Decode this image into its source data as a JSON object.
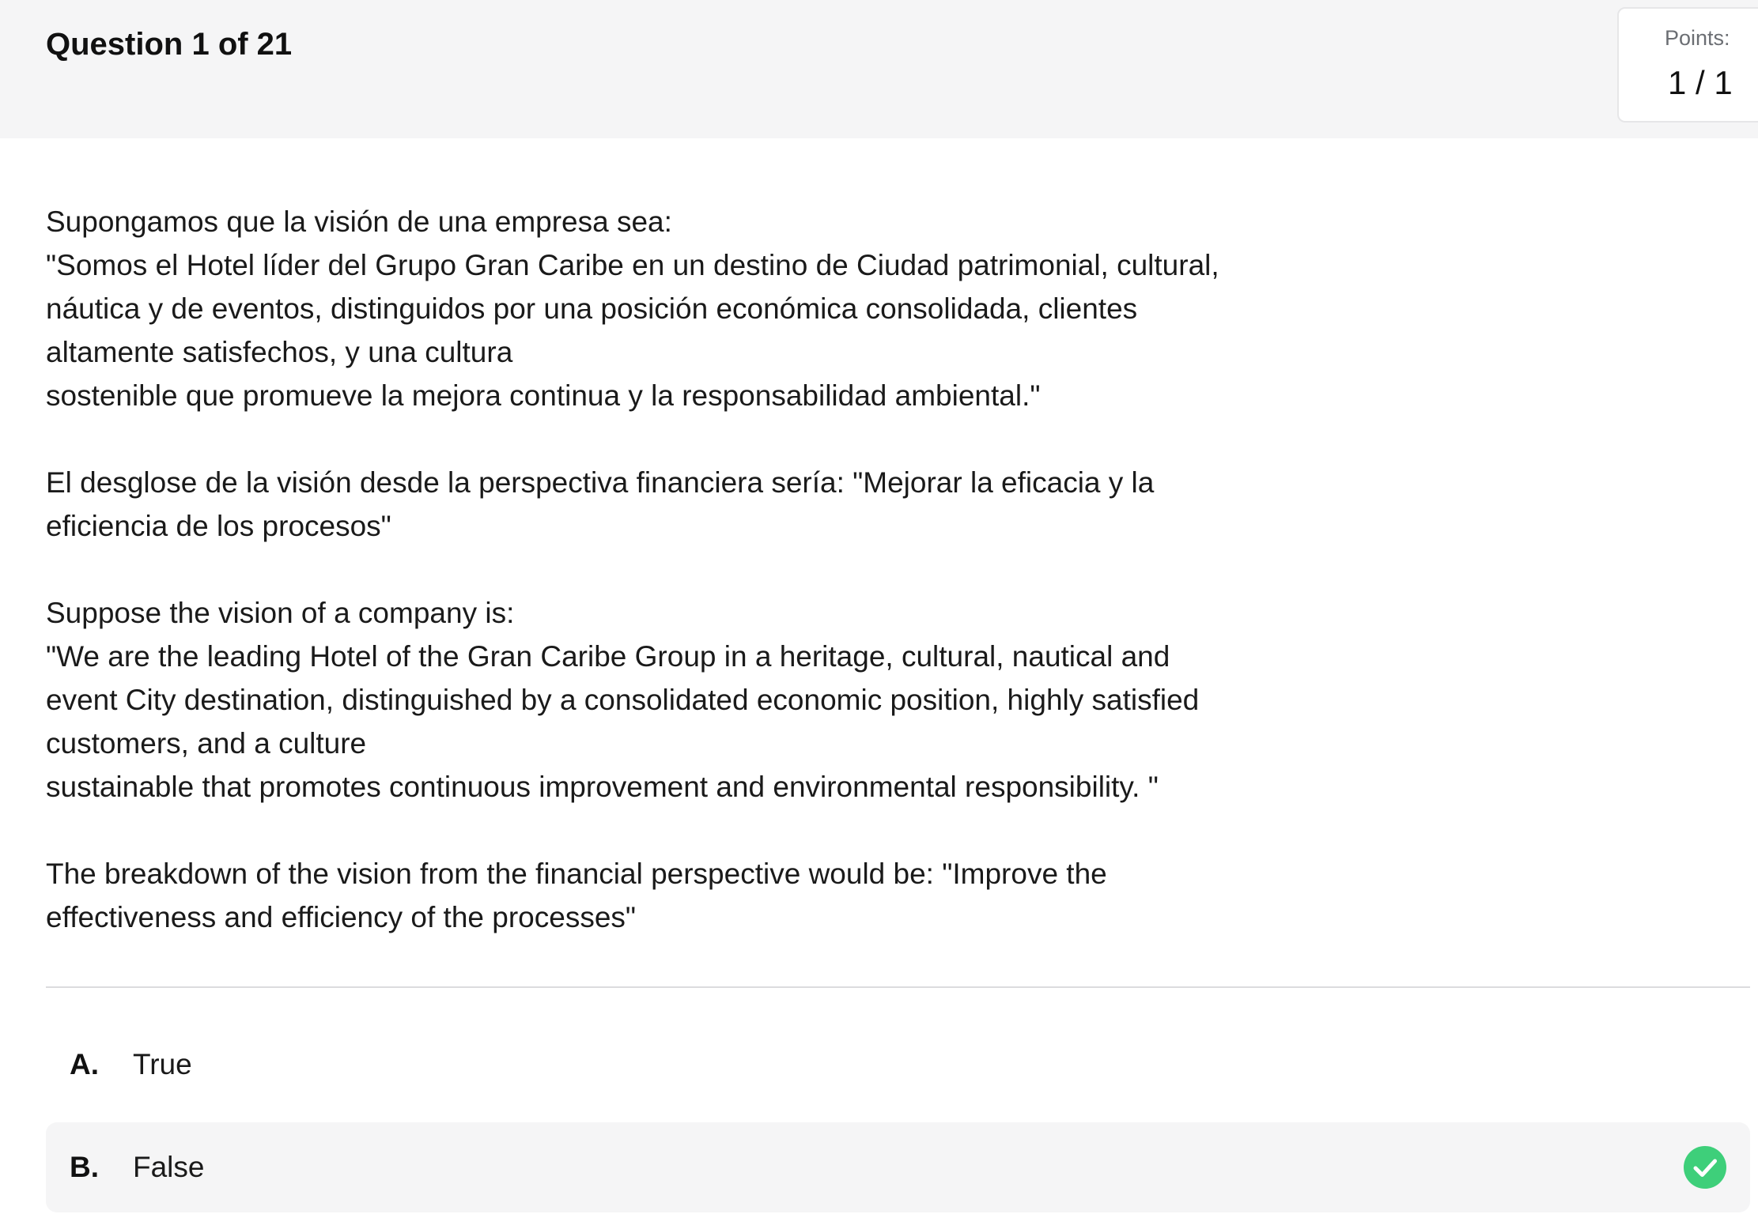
{
  "header": {
    "title": "Question 1 of 21",
    "points_label": "Points:",
    "points_value": "1 / 1"
  },
  "question": {
    "paragraphs": [
      [
        "Supongamos que la visión de una empresa sea:",
        "\"Somos el Hotel líder del Grupo Gran Caribe en un destino de Ciudad patrimonial, cultural,",
        "náutica y de eventos, distinguidos por una posición económica consolidada, clientes",
        "altamente satisfechos, y una cultura",
        "sostenible que promueve la mejora continua y la responsabilidad ambiental.\""
      ],
      [
        "El desglose de la visión desde la perspectiva financiera sería: \"Mejorar la eficacia y la",
        "eficiencia de los procesos\""
      ],
      [
        "Suppose the vision of a company is:",
        "\"We are the leading Hotel of the Gran Caribe Group in a heritage, cultural, nautical and",
        "event City destination, distinguished by a consolidated economic position, highly satisfied",
        "customers, and a culture",
        "sustainable that promotes continuous improvement and environmental responsibility. \""
      ],
      [
        "The breakdown of the vision from the financial perspective would be: \"Improve the",
        "effectiveness and efficiency of the processes\""
      ]
    ]
  },
  "options": [
    {
      "letter": "A.",
      "text": "True",
      "selected": false
    },
    {
      "letter": "B.",
      "text": "False",
      "selected": true,
      "icon": "check-circle-icon"
    }
  ],
  "colors": {
    "header_bg": "#f5f5f6",
    "selected_bg": "#f5f5f6",
    "correct_green": "#3ecf7a"
  }
}
